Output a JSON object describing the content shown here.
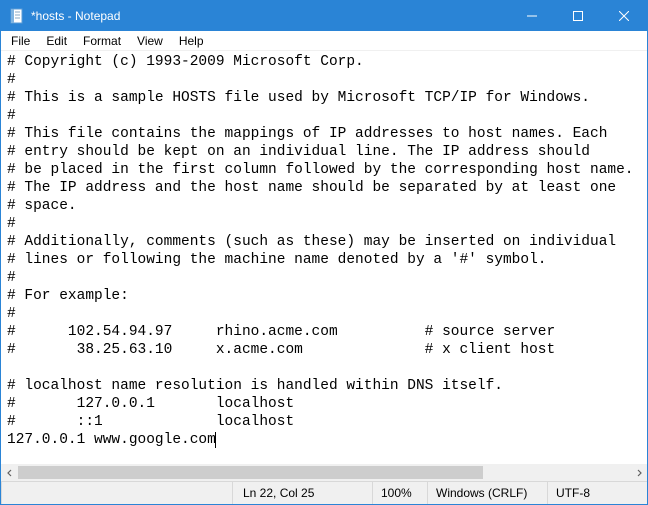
{
  "window": {
    "title": "*hosts - Notepad"
  },
  "menu": {
    "file": "File",
    "edit": "Edit",
    "format": "Format",
    "view": "View",
    "help": "Help"
  },
  "editor": {
    "content": "# Copyright (c) 1993-2009 Microsoft Corp.\n#\n# This is a sample HOSTS file used by Microsoft TCP/IP for Windows.\n#\n# This file contains the mappings of IP addresses to host names. Each\n# entry should be kept on an individual line. The IP address should\n# be placed in the first column followed by the corresponding host name.\n# The IP address and the host name should be separated by at least one\n# space.\n#\n# Additionally, comments (such as these) may be inserted on individual\n# lines or following the machine name denoted by a '#' symbol.\n#\n# For example:\n#\n#      102.54.94.97     rhino.acme.com          # source server\n#       38.25.63.10     x.acme.com              # x client host\n\n# localhost name resolution is handled within DNS itself.\n#       127.0.0.1       localhost\n#       ::1             localhost\n127.0.0.1 www.google.com"
  },
  "status": {
    "position": "Ln 22, Col 25",
    "zoom": "100%",
    "eol": "Windows (CRLF)",
    "encoding": "UTF-8"
  }
}
